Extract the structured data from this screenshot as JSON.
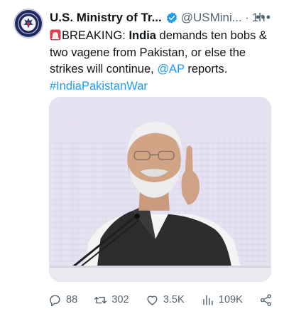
{
  "account": {
    "name": "U.S. Ministry of Tr...",
    "handle": "@USMini...",
    "separator": "·",
    "time": "1h",
    "more_label": "•••"
  },
  "post": {
    "prefix": "BREAKING: ",
    "bold": "India",
    "text_1": " demands ten bobs & two vagene from Pakistan, or else the strikes will continue, ",
    "mention": "@AP",
    "text_2": " reports.",
    "hashtag": "#IndiaPakistanWar"
  },
  "metrics": {
    "replies": "88",
    "reposts": "302",
    "likes": "3.5K",
    "views": "109K"
  },
  "icons": {
    "verified": "verified-badge-icon",
    "siren": "siren-emoji-icon",
    "reply": "reply-icon",
    "repost": "repost-icon",
    "like": "heart-icon",
    "views": "views-icon",
    "share": "share-icon"
  },
  "colors": {
    "link": "#1d9bf0",
    "muted": "#536471",
    "text": "#0f1419"
  }
}
